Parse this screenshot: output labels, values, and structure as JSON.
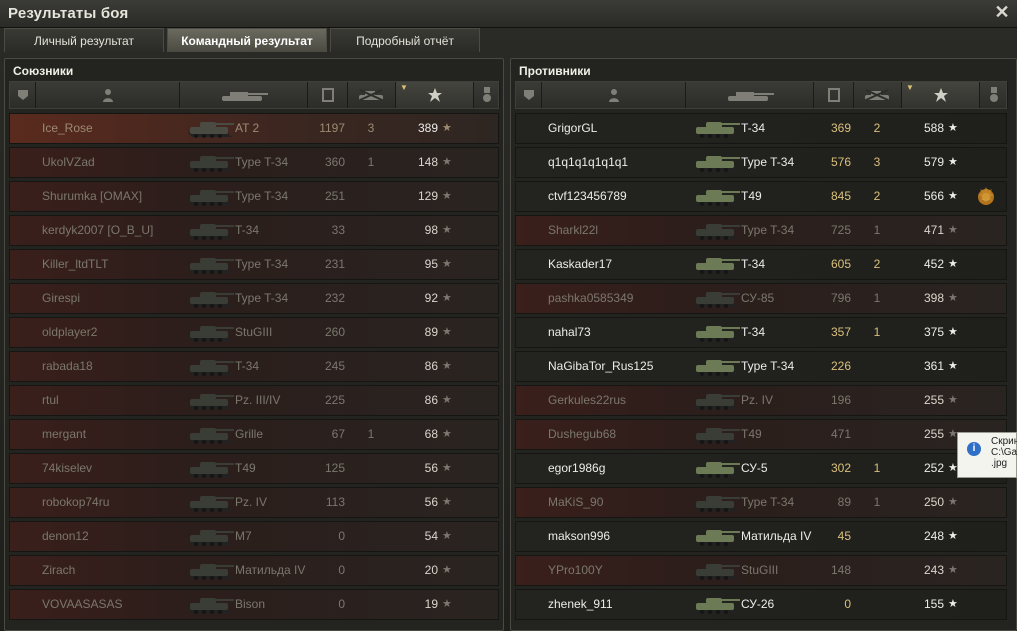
{
  "window": {
    "title": "Результаты боя",
    "close_label": "✕"
  },
  "tabs": [
    {
      "label": "Личный результат"
    },
    {
      "label": "Командный результат"
    },
    {
      "label": "Подробный отчёт"
    }
  ],
  "allies": {
    "title": "Союзники",
    "rows": [
      {
        "name": "Ice_Rose",
        "tank": "AT 2",
        "damage": "1197",
        "kills": "3",
        "xp": "389",
        "state": "player"
      },
      {
        "name": "UkolVZad",
        "tank": "Type T-34",
        "damage": "360",
        "kills": "1",
        "xp": "148",
        "state": "dead"
      },
      {
        "name": "Shurumka [OMAX]",
        "tank": "Type T-34",
        "damage": "251",
        "kills": "",
        "xp": "129",
        "state": "dead"
      },
      {
        "name": "kerdyk2007 [O_B_U]",
        "tank": "T-34",
        "damage": "33",
        "kills": "",
        "xp": "98",
        "state": "dead"
      },
      {
        "name": "Killer_ltdTLT",
        "tank": "Type T-34",
        "damage": "231",
        "kills": "",
        "xp": "95",
        "state": "dead"
      },
      {
        "name": "Girespi",
        "tank": "Type T-34",
        "damage": "232",
        "kills": "",
        "xp": "92",
        "state": "dead"
      },
      {
        "name": "oldplayer2",
        "tank": "StuGIII",
        "damage": "260",
        "kills": "",
        "xp": "89",
        "state": "dead"
      },
      {
        "name": "rabada18",
        "tank": "T-34",
        "damage": "245",
        "kills": "",
        "xp": "86",
        "state": "dead"
      },
      {
        "name": "rtul",
        "tank": "Pz. III/IV",
        "damage": "225",
        "kills": "",
        "xp": "86",
        "state": "dead"
      },
      {
        "name": "mergant",
        "tank": "Grille",
        "damage": "67",
        "kills": "1",
        "xp": "68",
        "state": "dead"
      },
      {
        "name": "74kiselev",
        "tank": "T49",
        "damage": "125",
        "kills": "",
        "xp": "56",
        "state": "dead"
      },
      {
        "name": "robokop74ru",
        "tank": "Pz. IV",
        "damage": "113",
        "kills": "",
        "xp": "56",
        "state": "dead"
      },
      {
        "name": "denon12",
        "tank": "M7",
        "damage": "0",
        "kills": "",
        "xp": "54",
        "state": "dead"
      },
      {
        "name": "Zirach",
        "tank": "Матильда IV",
        "damage": "0",
        "kills": "",
        "xp": "20",
        "state": "dead"
      },
      {
        "name": "VOVAASASAS",
        "tank": "Bison",
        "damage": "0",
        "kills": "",
        "xp": "19",
        "state": "dead"
      }
    ]
  },
  "enemies": {
    "title": "Противники",
    "rows": [
      {
        "name": "GrigorGL",
        "tank": "T-34",
        "damage": "369",
        "kills": "2",
        "xp": "588",
        "state": "alive"
      },
      {
        "name": "q1q1q1q1q1q1",
        "tank": "Type T-34",
        "damage": "576",
        "kills": "3",
        "xp": "579",
        "state": "alive"
      },
      {
        "name": "ctvf123456789",
        "tank": "T49",
        "damage": "845",
        "kills": "2",
        "xp": "566",
        "state": "alive",
        "medal": true
      },
      {
        "name": "Sharkl22l",
        "tank": "Type T-34",
        "damage": "725",
        "kills": "1",
        "xp": "471",
        "state": "dead"
      },
      {
        "name": "Kaskader17",
        "tank": "T-34",
        "damage": "605",
        "kills": "2",
        "xp": "452",
        "state": "alive"
      },
      {
        "name": "pashka0585349",
        "tank": "СУ-85",
        "damage": "796",
        "kills": "1",
        "xp": "398",
        "state": "dead"
      },
      {
        "name": "nahal73",
        "tank": "T-34",
        "damage": "357",
        "kills": "1",
        "xp": "375",
        "state": "alive"
      },
      {
        "name": "NaGibaTor_Rus125",
        "tank": "Type T-34",
        "damage": "226",
        "kills": "",
        "xp": "361",
        "state": "alive"
      },
      {
        "name": "Gerkules22rus",
        "tank": "Pz. IV",
        "damage": "196",
        "kills": "",
        "xp": "255",
        "state": "dead"
      },
      {
        "name": "Dushegub68",
        "tank": "T49",
        "damage": "471",
        "kills": "",
        "xp": "255",
        "state": "dead"
      },
      {
        "name": "egor1986g",
        "tank": "СУ-5",
        "damage": "302",
        "kills": "1",
        "xp": "252",
        "state": "alive"
      },
      {
        "name": "MaKiS_90",
        "tank": "Type T-34",
        "damage": "89",
        "kills": "1",
        "xp": "250",
        "state": "dead"
      },
      {
        "name": "makson996",
        "tank": "Матильда IV",
        "damage": "45",
        "kills": "",
        "xp": "248",
        "state": "alive"
      },
      {
        "name": "YPro100Y",
        "tank": "StuGIII",
        "damage": "148",
        "kills": "",
        "xp": "243",
        "state": "dead"
      },
      {
        "name": "zhenek_911",
        "tank": "СУ-26",
        "damage": "0",
        "kills": "",
        "xp": "155",
        "state": "alive"
      }
    ]
  },
  "icons": {
    "squad": "squad-icon",
    "player": "player-icon",
    "tank": "tank-icon",
    "damage": "shield-icon",
    "kills": "destroyed-tank-icon",
    "xp": "star-icon",
    "medals": "medal-icon",
    "star_glyph": "★"
  },
  "tooltip": {
    "lines": [
      "Скрин",
      "C:\\Ga",
      ".jpg"
    ],
    "info_glyph": "i"
  }
}
